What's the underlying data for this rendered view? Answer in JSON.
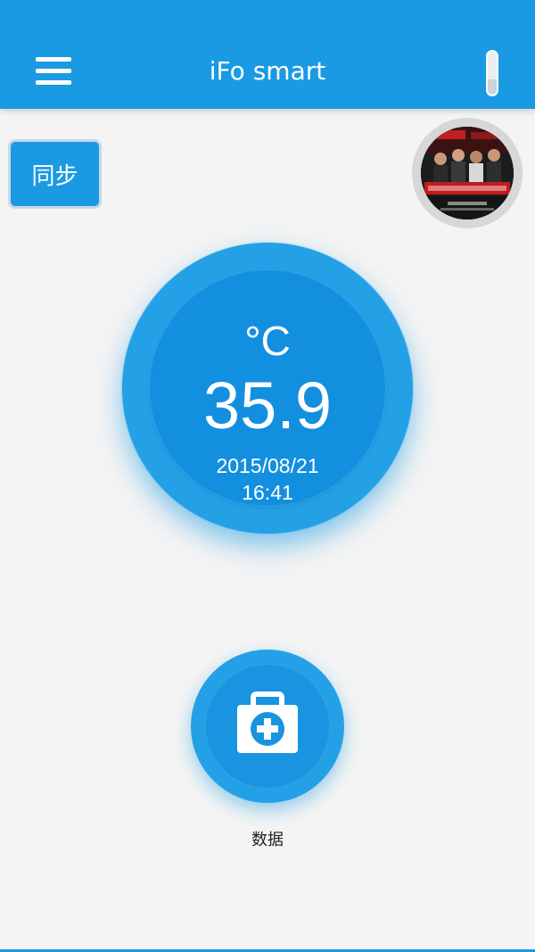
{
  "header": {
    "title": "iFo smart",
    "menu_icon": "hamburger-menu-icon",
    "battery_icon": "battery-icon",
    "battery_level": 0.35,
    "background_color": "#1a9ae3"
  },
  "sync": {
    "label": "同步"
  },
  "avatar": {
    "icon": "user-avatar-image"
  },
  "reading": {
    "unit": "°C",
    "temperature": "35.9",
    "date": "2015/08/21",
    "time": "16:41"
  },
  "data_button": {
    "icon": "medical-kit-icon",
    "label": "数据"
  },
  "colors": {
    "accent": "#1a9ae3",
    "gauge_inner": "#138fe0",
    "background": "#f4f4f4"
  }
}
